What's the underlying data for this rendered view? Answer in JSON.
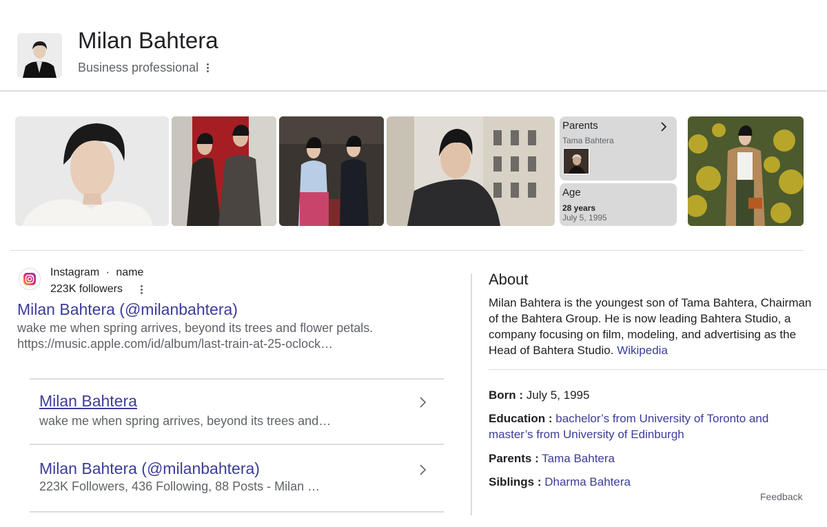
{
  "header": {
    "title": "Milan Bahtera",
    "subtitle": "Business professional"
  },
  "cards": {
    "parents": {
      "label": "Parents",
      "name": "Tama Bahtera"
    },
    "age": {
      "label": "Age",
      "value": "28 years",
      "date": "July 5, 1995"
    }
  },
  "instagram": {
    "source": "Instagram",
    "source_sep": "·",
    "source_type": "name",
    "followers": "223K followers",
    "title": "Milan Bahtera (@milanbahtera)",
    "snippet_line1": "wake me when spring arrives, beyond its trees and flower petals.",
    "snippet_line2": "https://music.apple.com/id/album/last-train-at-25-oclock…"
  },
  "subresults": [
    {
      "title": "Milan Bahtera",
      "snippet": "wake me when spring arrives, beyond its trees and…"
    },
    {
      "title": "Milan Bahtera (@milanbahtera)",
      "snippet": "223K Followers, 436 Following, 88 Posts - Milan …"
    }
  ],
  "about": {
    "heading": "About",
    "text": "Milan Bahtera is the youngest son of Tama Bahtera, Chairman of the Bahtera Group. He is now leading Bahtera Studio, a company focusing on film, modeling, and advertising as the Head of Bahtera Studio.",
    "source_link": "Wikipedia",
    "facts": {
      "born_label": "Born :",
      "born_value": "July 5, 1995",
      "education_label": "Education :",
      "education_value": "bachelor’s from University of Toronto and master’s from University of Edinburgh",
      "parents_label": "Parents :",
      "parents_value": "Tama Bahtera",
      "siblings_label": "Siblings :",
      "siblings_value": "Dharma Bahtera"
    }
  },
  "feedback": "Feedback",
  "colors": {
    "link": "#3c3c99",
    "card_bg": "#d9d9d9",
    "divider": "#dadce0"
  }
}
